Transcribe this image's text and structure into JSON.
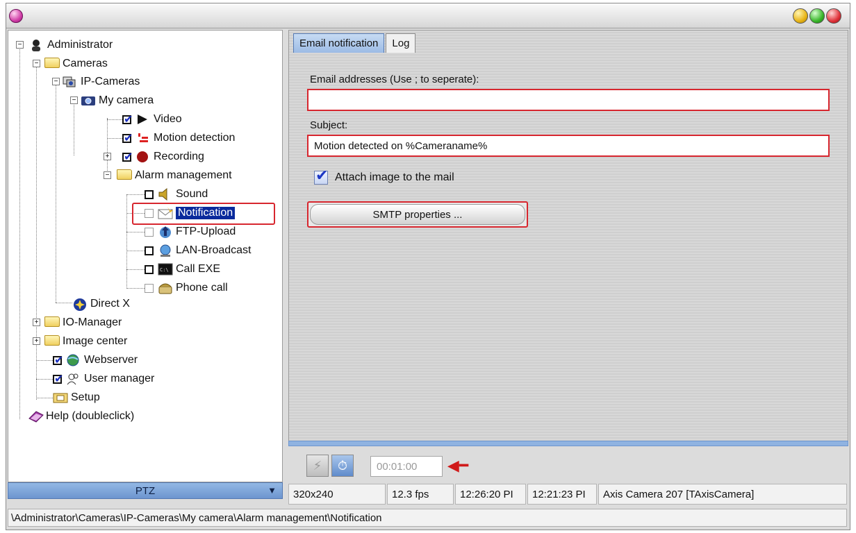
{
  "window": {
    "title": ""
  },
  "tree": {
    "items": [
      {
        "id": "administrator",
        "label": "Administrator"
      },
      {
        "id": "cameras",
        "label": "Cameras"
      },
      {
        "id": "ip-cameras",
        "label": "IP-Cameras"
      },
      {
        "id": "my-camera",
        "label": "My camera"
      },
      {
        "id": "video",
        "label": "Video",
        "checked": true
      },
      {
        "id": "motion-detection",
        "label": "Motion detection",
        "checked": true
      },
      {
        "id": "recording",
        "label": "Recording",
        "checked": true
      },
      {
        "id": "alarm-management",
        "label": "Alarm management"
      },
      {
        "id": "sound",
        "label": "Sound",
        "checked": false
      },
      {
        "id": "notification",
        "label": "Notification",
        "checked": false,
        "selected": true
      },
      {
        "id": "ftp-upload",
        "label": "FTP-Upload",
        "checked": false
      },
      {
        "id": "lan-broadcast",
        "label": "LAN-Broadcast",
        "checked": false
      },
      {
        "id": "call-exe",
        "label": "Call EXE",
        "checked": false
      },
      {
        "id": "phone-call",
        "label": "Phone call",
        "checked": false
      },
      {
        "id": "direct-x",
        "label": "Direct X"
      },
      {
        "id": "io-manager",
        "label": "IO-Manager"
      },
      {
        "id": "image-center",
        "label": "Image center"
      },
      {
        "id": "webserver",
        "label": "Webserver",
        "checked": true
      },
      {
        "id": "user-manager",
        "label": "User manager",
        "checked": true
      },
      {
        "id": "setup",
        "label": "Setup"
      },
      {
        "id": "help",
        "label": "Help (doubleclick)"
      }
    ]
  },
  "ptz": {
    "label": "PTZ"
  },
  "tabs": [
    {
      "label": "Email notification",
      "active": true
    },
    {
      "label": "Log",
      "active": false
    }
  ],
  "form": {
    "email_label": "Email addresses (Use ; to seperate):",
    "email_value": "",
    "subject_label": "Subject:",
    "subject_value": "Motion detected on %Cameraname%",
    "attach_label": "Attach image to the mail",
    "attach_checked": true,
    "smtp_button": "SMTP properties ..."
  },
  "timer": {
    "value": "00:01:00"
  },
  "status": {
    "resolution": "320x240",
    "fps": "12.3 fps",
    "time1": "12:26:20 PI",
    "time2": "12:21:23 PI",
    "camera": "Axis Camera 207 [TAxisCamera]"
  },
  "path": "\\Administrator\\Cameras\\IP-Cameras\\My camera\\Alarm management\\Notification",
  "colors": {
    "highlight_red": "#d7262e",
    "selection_blue": "#0a2a9c",
    "tab_blue": "#9cbbe5"
  }
}
